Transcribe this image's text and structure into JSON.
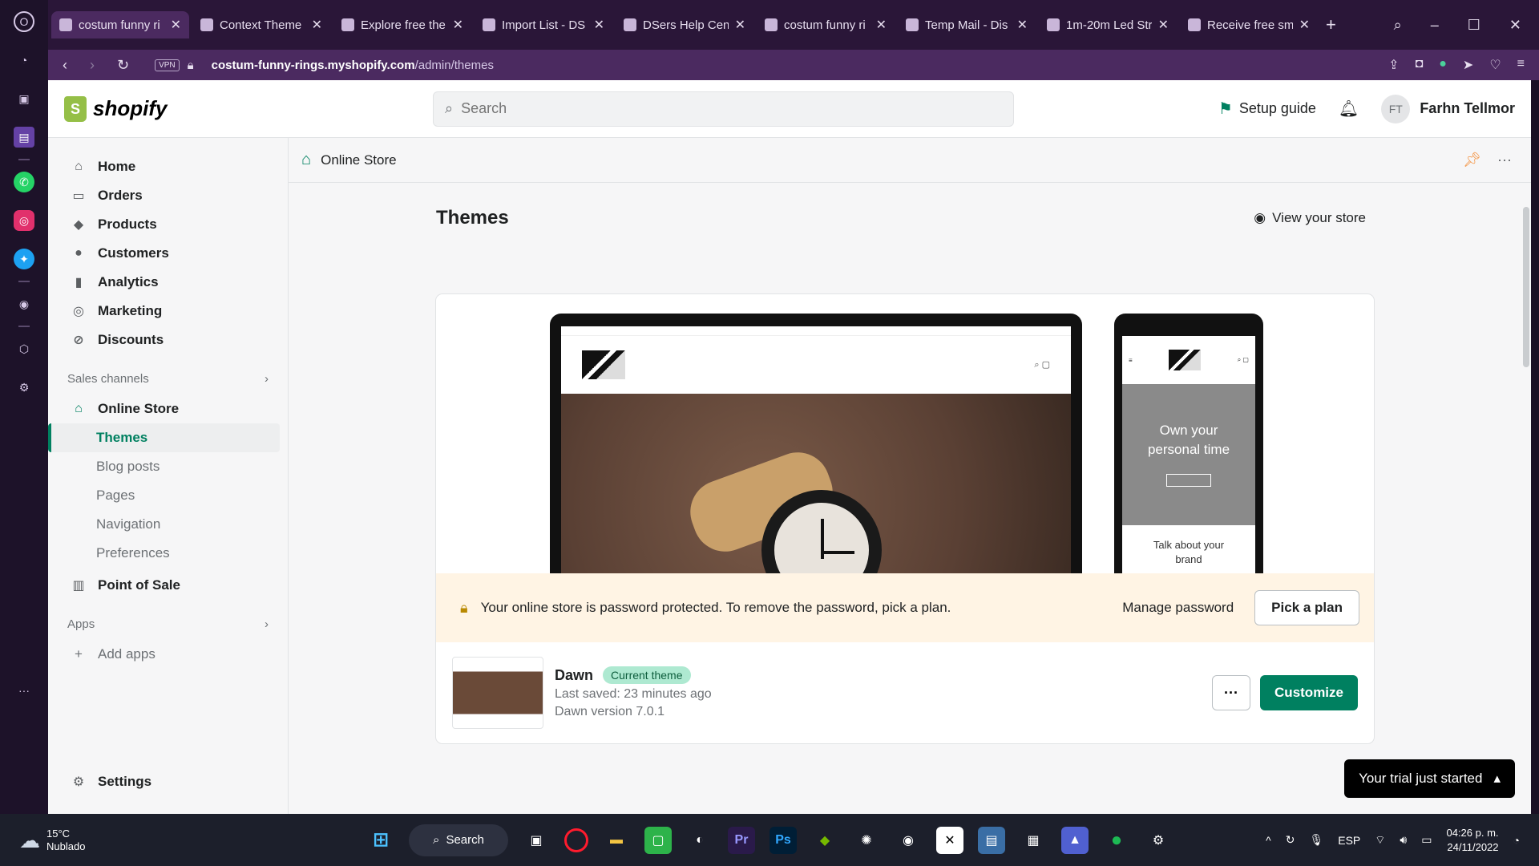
{
  "browser": {
    "tabs": [
      {
        "label": "costum funny ri",
        "active": true
      },
      {
        "label": "Context Theme",
        "active": false
      },
      {
        "label": "Explore free the",
        "active": false
      },
      {
        "label": "Import List - DS",
        "active": false
      },
      {
        "label": "DSers Help Cent",
        "active": false
      },
      {
        "label": "costum funny ri",
        "active": false
      },
      {
        "label": "Temp Mail - Dis",
        "active": false
      },
      {
        "label": "1m-20m Led Str",
        "active": false
      },
      {
        "label": "Receive free sm",
        "active": false
      }
    ],
    "vpn_label": "VPN",
    "url_host": "costum-funny-rings.myshopify.com",
    "url_path": "/admin/themes"
  },
  "shopify": {
    "brand": "shopify",
    "search_placeholder": "Search",
    "setup_guide": "Setup guide",
    "user_initials": "FT",
    "user_name": "Farhn Tellmor"
  },
  "nav": {
    "items": [
      "Home",
      "Orders",
      "Products",
      "Customers",
      "Analytics",
      "Marketing",
      "Discounts"
    ],
    "sales_channels_label": "Sales channels",
    "online_store": "Online Store",
    "online_store_subs": [
      "Themes",
      "Blog posts",
      "Pages",
      "Navigation",
      "Preferences"
    ],
    "point_of_sale": "Point of Sale",
    "apps_label": "Apps",
    "add_apps": "Add apps",
    "settings": "Settings"
  },
  "main": {
    "breadcrumb": "Online Store",
    "title": "Themes",
    "view_store": "View your store",
    "preview": {
      "phone_hero_line1": "Own your",
      "phone_hero_line2": "personal time",
      "phone_foot_line1": "Talk about your",
      "phone_foot_line2": "brand"
    },
    "banner": {
      "text": "Your online store is password protected. To remove the password, pick a plan.",
      "manage_password": "Manage password",
      "pick_plan": "Pick a plan"
    },
    "theme": {
      "name": "Dawn",
      "badge": "Current theme",
      "last_saved": "Last saved: 23 minutes ago",
      "version": "Dawn version 7.0.1",
      "customize": "Customize"
    },
    "trial": "Your trial just started"
  },
  "taskbar": {
    "temperature": "15°C",
    "weather": "Nublado",
    "search": "Search",
    "lang": "ESP",
    "time": "04:26 p. m.",
    "date": "24/11/2022"
  },
  "colors": {
    "brand_green": "#008060",
    "browser_purple": "#4b2a60",
    "banner_bg": "#fff4e4"
  }
}
